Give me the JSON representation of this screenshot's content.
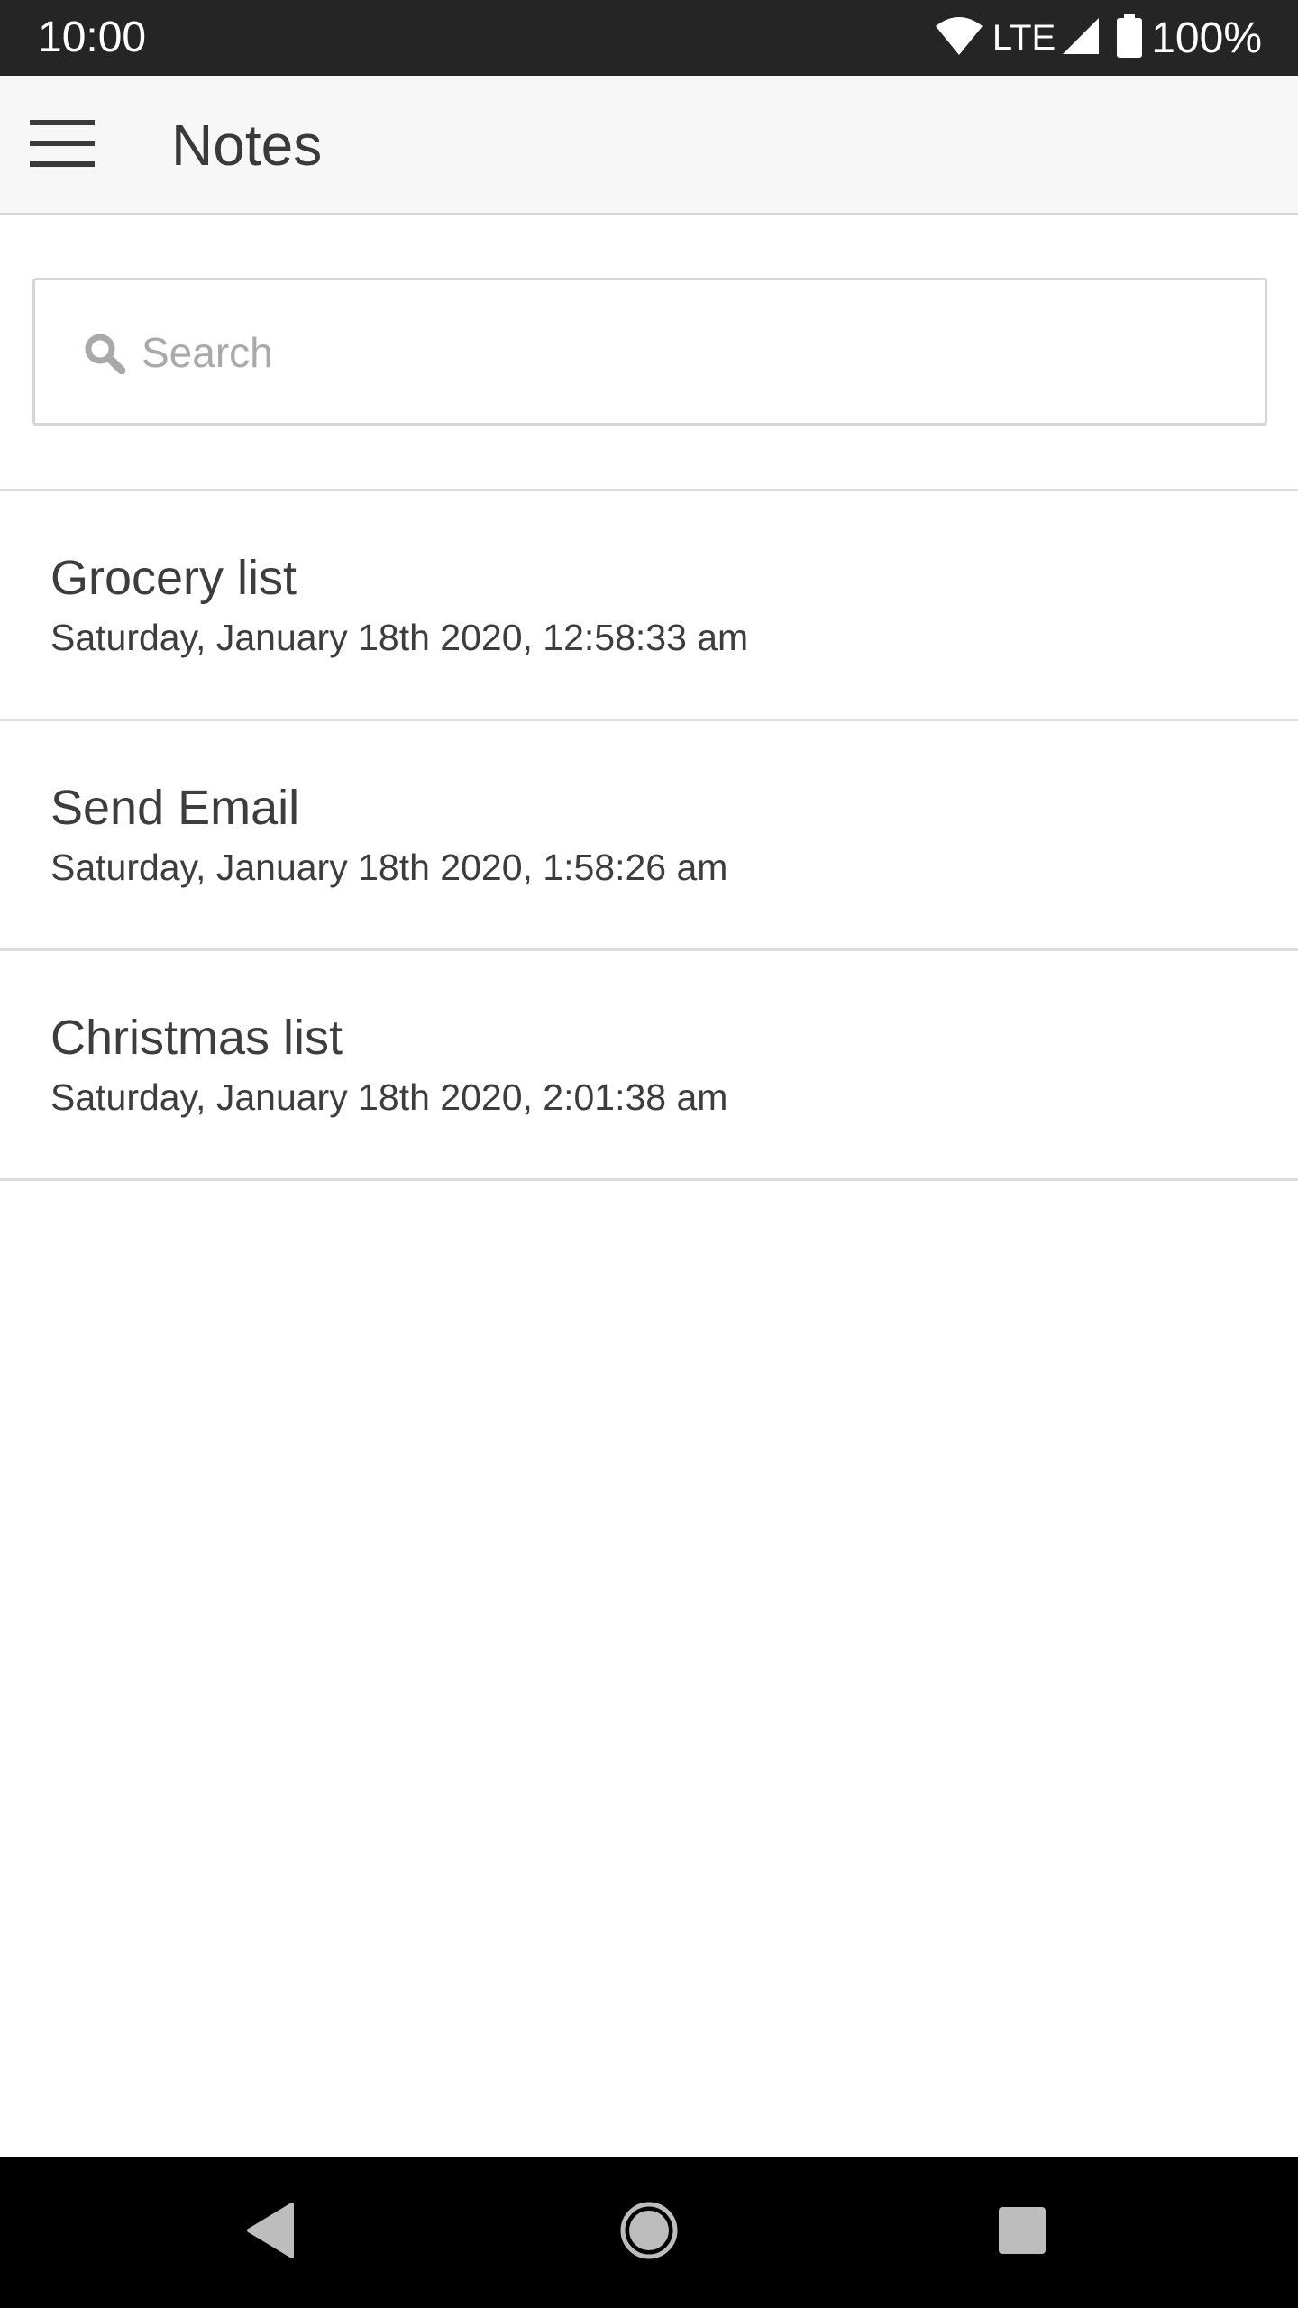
{
  "status_bar": {
    "time": "10:00",
    "network": "LTE",
    "battery": "100%",
    "icons": [
      "wifi-icon",
      "signal-icon",
      "battery-icon"
    ]
  },
  "app_bar": {
    "title": "Notes",
    "menu_icon": "hamburger-menu-icon"
  },
  "search": {
    "placeholder": "Search",
    "value": "",
    "icon": "search-icon"
  },
  "notes": [
    {
      "title": "Grocery list",
      "date": "Saturday, January 18th 2020, 12:58:33 am"
    },
    {
      "title": "Send Email",
      "date": "Saturday, January 18th 2020, 1:58:26 am"
    },
    {
      "title": "Christmas list",
      "date": "Saturday, January 18th 2020, 2:01:38 am"
    }
  ],
  "nav_bar": {
    "buttons": [
      "back-icon",
      "home-icon",
      "recents-icon"
    ]
  },
  "colors": {
    "status_bar_bg": "#252525",
    "app_bar_bg": "#f7f7f7",
    "text": "#3d3d3d",
    "divider": "#dcdcdc",
    "nav_bar_bg": "#000000"
  }
}
